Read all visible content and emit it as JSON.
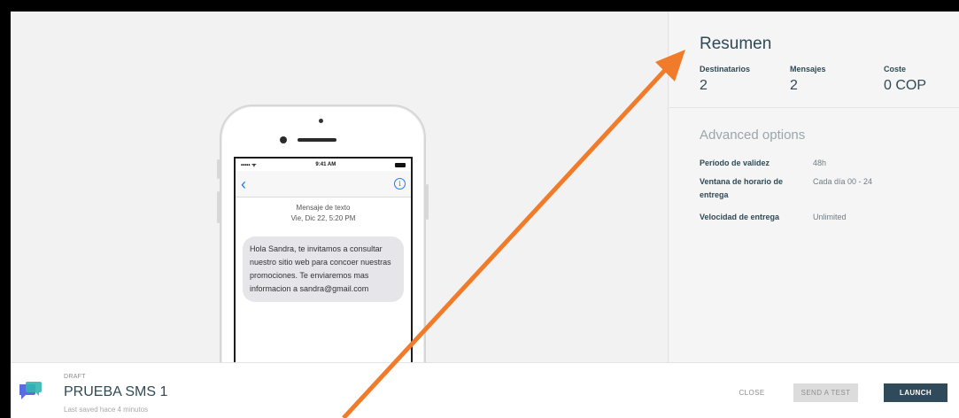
{
  "phone": {
    "status_dots": "••••• ᯤ",
    "status_time": "9:41 AM",
    "back_glyph": "‹",
    "info_glyph": "i",
    "message_type": "Mensaje de texto",
    "message_date": "Vie, Dic 22, 5:20 PM",
    "message_body": "Hola Sandra, te invitamos a consultar nuestro sitio web para concoer nuestras promociones. Te enviaremos mas informacion a sandra@gmail.com"
  },
  "summary": {
    "title": "Resumen",
    "stats": [
      {
        "label": "Destinatarios",
        "value": "2"
      },
      {
        "label": "Mensajes",
        "value": "2"
      },
      {
        "label": "Coste",
        "value": "0 COP"
      }
    ],
    "advanced_title": "Advanced options",
    "options": [
      {
        "label": "Período de validez",
        "value": "48h"
      },
      {
        "label": "Ventana de horario de entrega",
        "value": "Cada día 00 - 24"
      },
      {
        "label": "Velocidad de entrega",
        "value": "Unlimited"
      }
    ]
  },
  "footer": {
    "status": "DRAFT",
    "campaign_name": "PRUEBA SMS 1",
    "last_saved": "Last saved hace 4 minutos",
    "close_label": "CLOSE",
    "test_label": "SEND A TEST",
    "launch_label": "LAUNCH"
  },
  "colors": {
    "accent_dark": "#2f4a5a",
    "ios_blue": "#1e7cf2",
    "annotation_arrow": "#f07c2b"
  },
  "icons": {
    "campaign": "chat-bubbles-icon",
    "back": "chevron-left-icon",
    "info": "info-icon"
  }
}
